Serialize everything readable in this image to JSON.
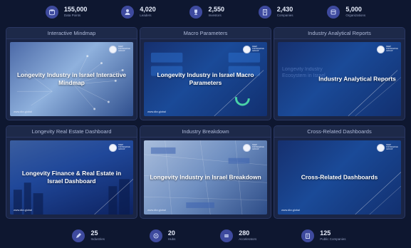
{
  "top_stats": [
    {
      "value": "155,000",
      "label": "Data Points",
      "icon": "database-icon"
    },
    {
      "value": "4,020",
      "label": "Leaders",
      "icon": "person-icon"
    },
    {
      "value": "2,550",
      "label": "Investors",
      "icon": "trophy-icon"
    },
    {
      "value": "2,430",
      "label": "Companies",
      "icon": "building-icon"
    },
    {
      "value": "5,000",
      "label": "Organizations",
      "icon": "org-icon"
    }
  ],
  "panels": [
    {
      "title": "Interactive Mindmap",
      "thumb_title": "Longevity Industry in Israel Interactive Mindmap",
      "url": "www.dkv.global",
      "logo_text": "DEEP KNOWLEDGE GROUP"
    },
    {
      "title": "Macro Parameters",
      "thumb_title": "Longevity Industry in Israel Macro Parameters",
      "url": "www.dkv.global",
      "logo_text": "DEEP KNOWLEDGE GROUP"
    },
    {
      "title": "Industry Analytical Reports",
      "thumb_title": "Industry Analytical Reports",
      "thumb_bg_text": "Longevity Industry Ecosystem in Israel",
      "url": "",
      "logo_text": "DEEP KNOWLEDGE GROUP"
    },
    {
      "title": "Longevity Real Estate Dashboard",
      "thumb_title": "Longevity Finance & Real Estate in Israel Dashboard",
      "url": "www.dkv.global",
      "logo_text": "DEEP KNOWLEDGE GROUP"
    },
    {
      "title": "Industry Breakdown",
      "thumb_title": "Longevity Industry in Israel Breakdown",
      "url": "www.dkv.global",
      "logo_text": "DEEP KNOWLEDGE GROUP"
    },
    {
      "title": "Cross-Related Dashboards",
      "thumb_title": "Cross-Related Dashboards",
      "url": "www.dkv.global",
      "logo_text": "DEEP KNOWLEDGE GROUP"
    }
  ],
  "bottom_stats": [
    {
      "value": "25",
      "label": "Industries",
      "icon": "edit-icon"
    },
    {
      "value": "20",
      "label": "Hubs",
      "icon": "hub-icon"
    },
    {
      "value": "280",
      "label": "Accelerators",
      "icon": "accelerator-icon"
    },
    {
      "value": "125",
      "label": "Public Companies",
      "icon": "public-company-icon"
    }
  ],
  "colors": {
    "background": "#0e1730",
    "panel": "#1a2545",
    "icon_circle": "#3e4a9e"
  }
}
